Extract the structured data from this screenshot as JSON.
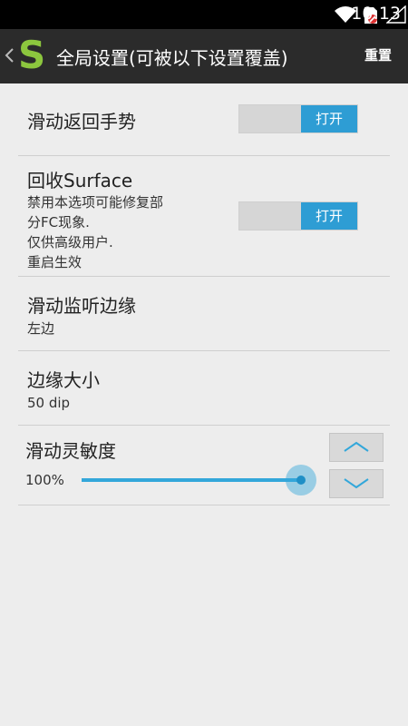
{
  "status_bar": {
    "time": "10:13"
  },
  "action_bar": {
    "logo_letter": "S",
    "title": "全局设置(可被以下设置覆盖)",
    "reset_label": "重置"
  },
  "settings": {
    "swipe_back": {
      "title": "滑动返回手势",
      "toggle_label": "打开",
      "enabled": true
    },
    "recycle_surface": {
      "title": "回收Surface",
      "description_lines": [
        "禁用本选项可能修复部",
        "分FC现象.",
        "仅供高级用户.",
        "重启生效"
      ],
      "toggle_label": "打开",
      "enabled": true
    },
    "listen_edge": {
      "title": "滑动监听边缘",
      "value": "左边"
    },
    "edge_size": {
      "title": "边缘大小",
      "value": "50 dip"
    },
    "sensitivity": {
      "title": "滑动灵敏度",
      "value_label": "100%",
      "value": 1.0
    }
  },
  "colors": {
    "accent": "#2e9dd4",
    "logo": "#8cc63e",
    "actionbar": "#2b2b2b"
  }
}
